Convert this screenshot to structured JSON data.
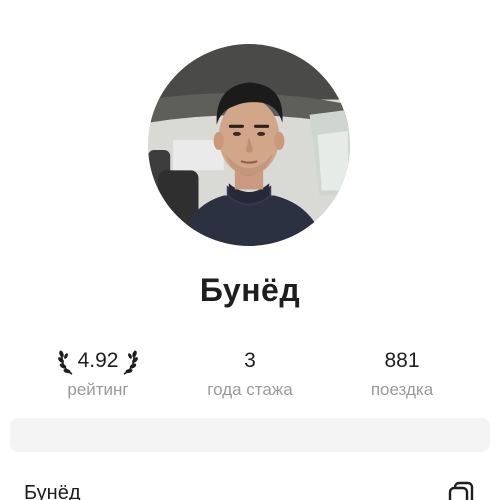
{
  "driver": {
    "name": "Бунёд"
  },
  "stats": {
    "rating": {
      "value": "4.92",
      "label": "рейтинг"
    },
    "experience": {
      "value": "3",
      "label": "года стажа"
    },
    "trips": {
      "value": "881",
      "label": "поездка"
    }
  },
  "details": {
    "name_row": "Бунёд"
  },
  "icons": {
    "laurel_left": "laurel-left-icon",
    "laurel_right": "laurel-right-icon",
    "copy": "copy-icon"
  },
  "colors": {
    "text": "#1e1e1e",
    "secondary_text": "#9a9a9a",
    "banner_bg": "#f4f4f4"
  }
}
